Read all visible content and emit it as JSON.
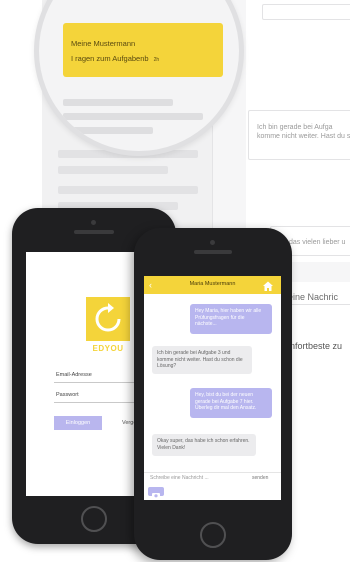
{
  "background": {
    "right_card_text": "Ich bin gerade bei Aufga\nkomme nicht weiter. Hast du scho",
    "right_card2_text": "das vielen lieber u",
    "right_label1": "eine Nachric",
    "right_label2": "nfortbeste zu"
  },
  "magnifier": {
    "name": "Meine Mustermann",
    "message": "I ragen zum Aufgabenb",
    "time": "2h"
  },
  "login": {
    "logo_icon": "refresh-icon",
    "logo_text": "EDYOU",
    "email_label": "Email-Adresse",
    "password_label": "Passwort",
    "login_button": "Einloggen",
    "forgot_link": "Vergessen"
  },
  "chat": {
    "back_icon": "back-arrow-icon",
    "title": "Maria Mustermann",
    "home_icon": "home-icon",
    "messages": [
      {
        "side": "right",
        "text": "Hey Maria, hier haben wir alle Prüfungsfragen für die nächste..."
      },
      {
        "side": "left",
        "text": "Ich bin gerade bei Aufgabe 3 und komme nicht weiter. Hast du schon die Lösung?"
      },
      {
        "side": "right",
        "text": "Hey, bist du bei der neuen gerade bei Aufgabe 7 hier. Überleg dir mal den Ansatz."
      },
      {
        "side": "left",
        "text": "Okay super, das habe ich schon erfahren. Vielen Dank!"
      }
    ],
    "input_placeholder": "Schreibe eine Nachricht ...",
    "send_label": "senden",
    "camera_icon": "camera-icon"
  },
  "colors": {
    "accent_yellow": "#f4d43a",
    "bubble_purple": "#b8b6ef",
    "phone_body": "#1f1f21"
  }
}
